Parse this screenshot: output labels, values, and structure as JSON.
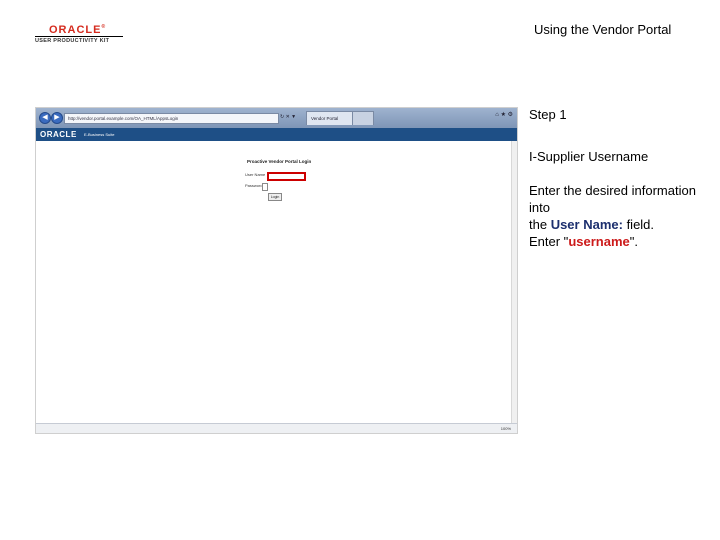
{
  "logo": {
    "word": "ORACLE",
    "reg": "®",
    "subtitle": "USER PRODUCTIVITY KIT"
  },
  "doc_title": "Using the Vendor Portal",
  "browser": {
    "url": "http://vendor.portal.example.com/OA_HTML/AppsLogin",
    "tabs": [
      "Vendor Portal",
      ""
    ],
    "zoom": "100%"
  },
  "app": {
    "logo": "ORACLE",
    "suite": "E-Business Suite",
    "portal_title": "Proactive Vendor Portal Login",
    "user_label": "User Name",
    "pass_label": "Password",
    "login_button": "Login"
  },
  "step": "Step 1",
  "step_title": "I-Supplier Username",
  "instructions": {
    "line1": "Enter the desired information into",
    "pre_field": "the ",
    "field_name": "User Name:",
    "post_field": " field.",
    "enter": "Enter \"",
    "value": "username",
    "end": "\"."
  },
  "colors": {
    "highlight": "#cc0000",
    "brand": "#d52b1e",
    "header": "#1e4f86"
  }
}
